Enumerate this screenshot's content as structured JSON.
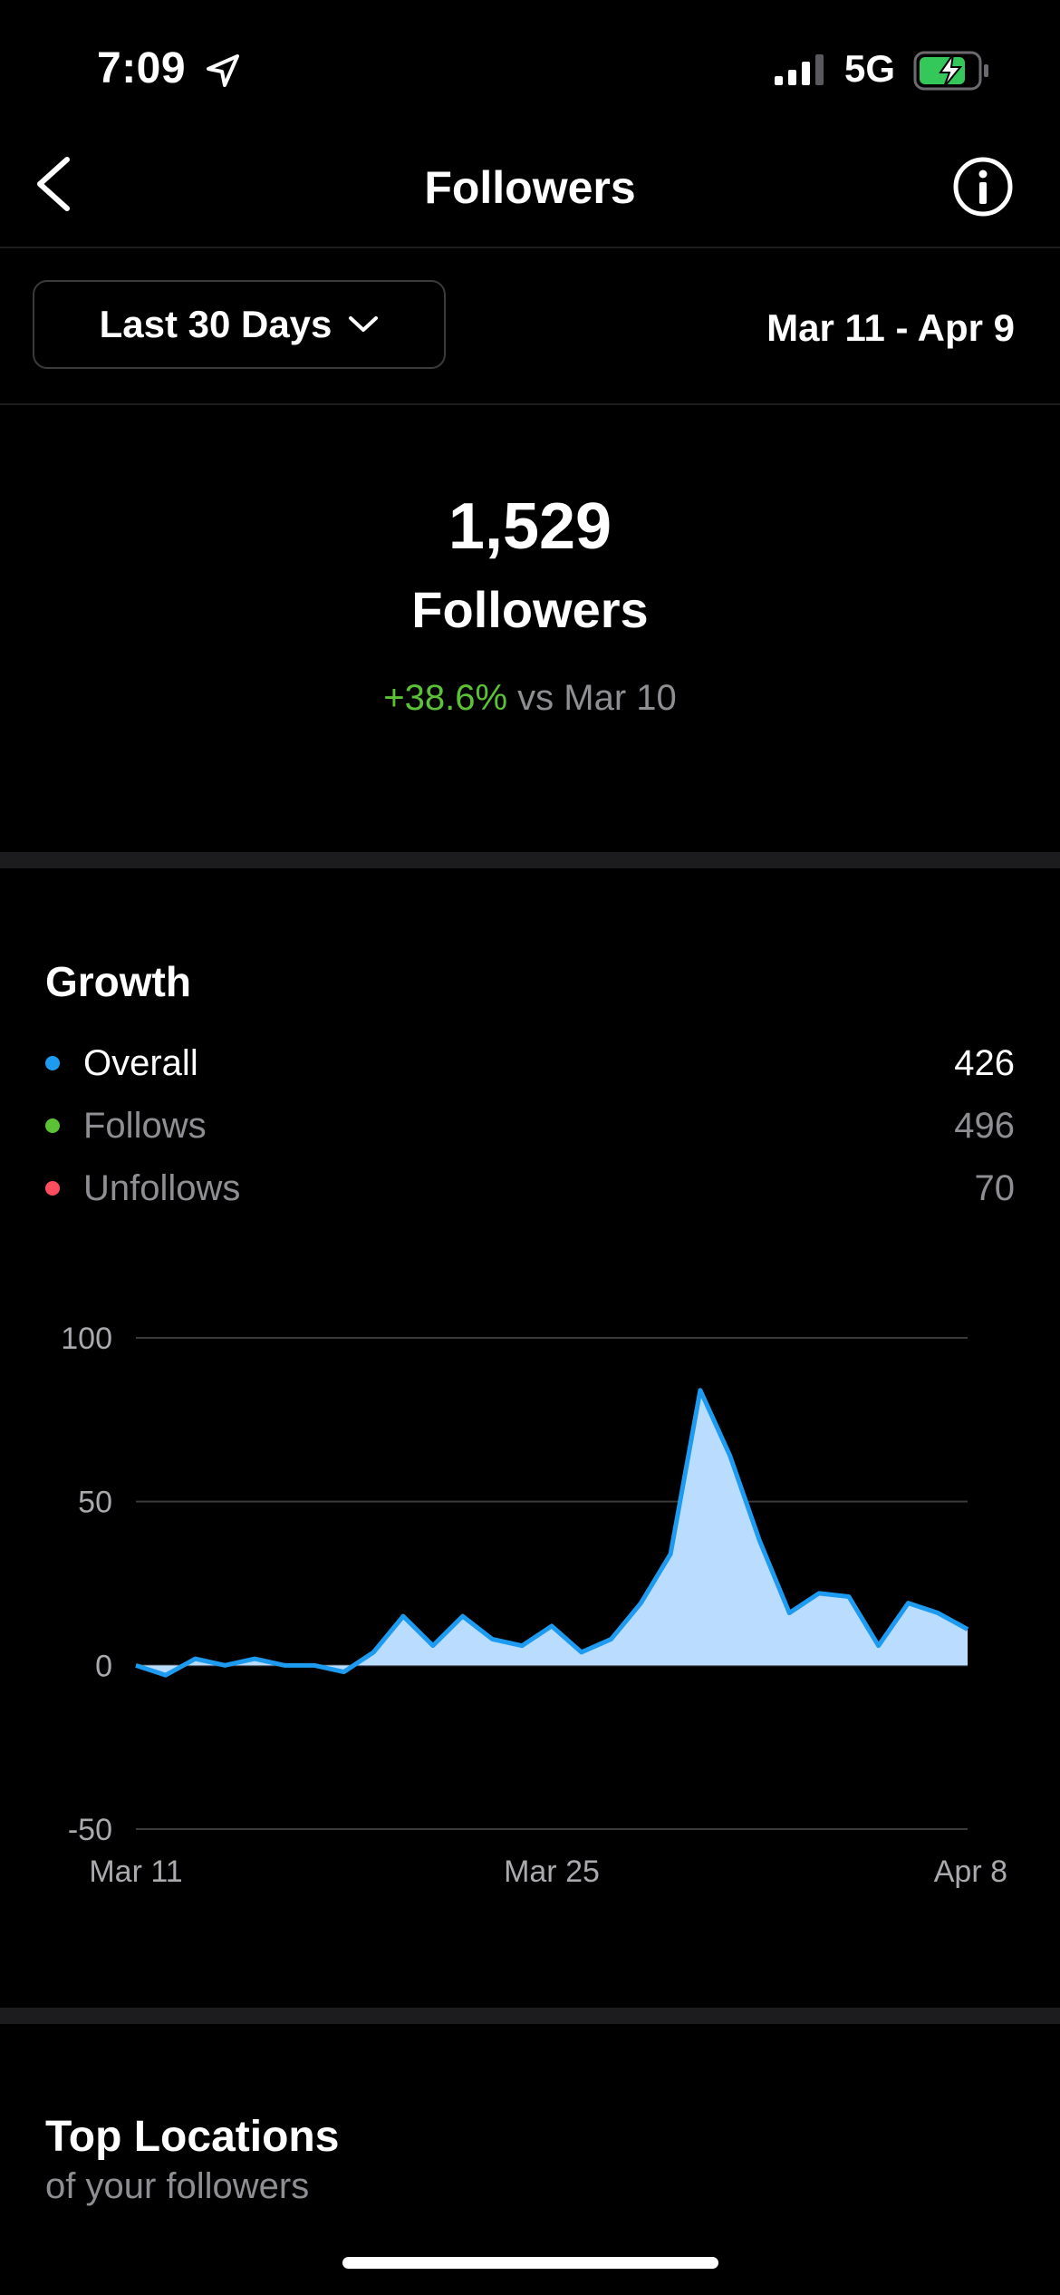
{
  "status_bar": {
    "time": "7:09",
    "network": "5G",
    "icons": [
      "location-arrow-icon",
      "signal-icon",
      "battery-charging-icon"
    ]
  },
  "nav": {
    "title": "Followers",
    "back_icon": "chevron-left-icon",
    "info_icon": "info-icon"
  },
  "filter": {
    "range_label": "Last 30 Days",
    "date_range": "Mar 11 - Apr 9"
  },
  "summary": {
    "count": "1,529",
    "label": "Followers",
    "change": "+38.6%",
    "comparison": "vs Mar 10"
  },
  "growth": {
    "title": "Growth",
    "legend": [
      {
        "label": "Overall",
        "value": "426",
        "color": "#1d9bf0"
      },
      {
        "label": "Follows",
        "value": "496",
        "color": "#5bc236"
      },
      {
        "label": "Unfollows",
        "value": "70",
        "color": "#ff4d5e"
      }
    ]
  },
  "chart_data": {
    "type": "area",
    "series": [
      {
        "name": "Overall",
        "color": "#1d9bf0",
        "fill": "#b9dcff",
        "values": [
          0,
          -3,
          2,
          0,
          2,
          0,
          0,
          -2,
          4,
          15,
          6,
          15,
          8,
          6,
          12,
          4,
          8,
          19,
          34,
          84,
          64,
          38,
          16,
          22,
          21,
          6,
          19,
          16,
          11
        ]
      }
    ],
    "x_tick_labels": [
      "Mar 11",
      "Mar 25",
      "Apr 8"
    ],
    "x_tick_index": [
      0,
      14,
      28
    ],
    "y_ticks": [
      100,
      50,
      0,
      -50
    ],
    "ylim": [
      -50,
      100
    ],
    "grid": true
  },
  "top_locations": {
    "title": "Top Locations",
    "subtitle": "of your followers"
  }
}
